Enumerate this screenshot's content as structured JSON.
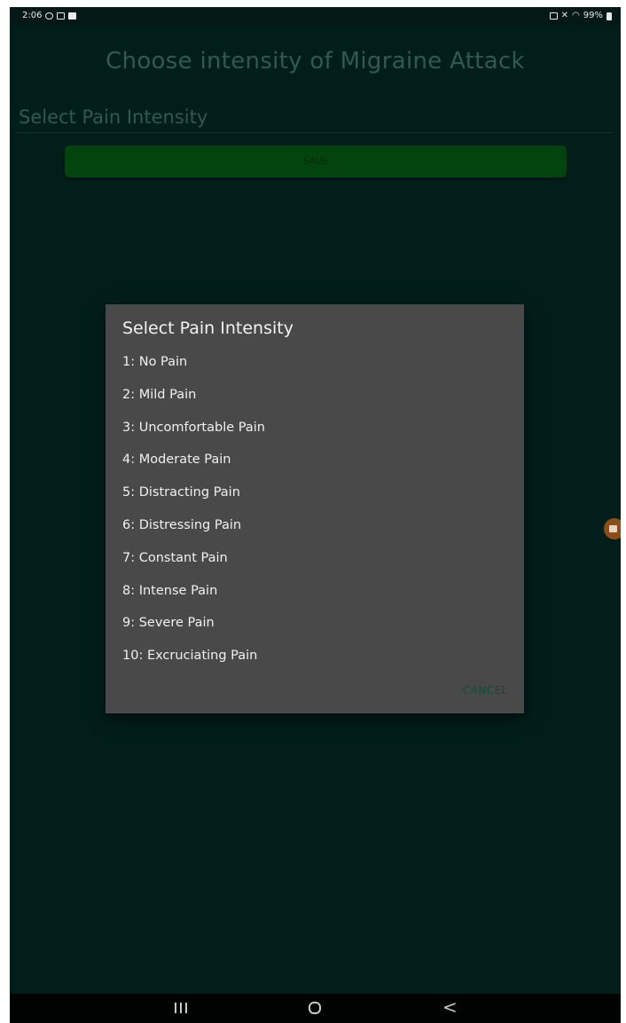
{
  "status_bar": {
    "time": "2:06",
    "battery": "99%"
  },
  "page": {
    "title": "Choose intensity of Migraine Attack",
    "field_label": "Select Pain Intensity",
    "save_label": "SAVE"
  },
  "dialog": {
    "title": "Select Pain Intensity",
    "options": [
      "1: No Pain",
      "2: Mild Pain",
      "3: Uncomfortable Pain",
      "4: Moderate Pain",
      "5: Distracting Pain",
      "6: Distressing Pain",
      "7: Constant Pain",
      "8: Intense Pain",
      "9: Severe Pain",
      "10: Excruciating Pain"
    ],
    "cancel_label": "CANCEL"
  },
  "navigation": {
    "back_glyph": "<"
  },
  "colors": {
    "background": "#021e1b",
    "dialog": "#494949",
    "save_button": "#03430d",
    "accent": "#0e4f3c"
  },
  "icons": [
    "notification-icon",
    "gallery-icon",
    "video-icon",
    "alarm-icon",
    "mute-icon",
    "wifi-icon",
    "battery-icon",
    "floating-recorder-icon",
    "recents-icon",
    "home-icon",
    "back-icon"
  ]
}
